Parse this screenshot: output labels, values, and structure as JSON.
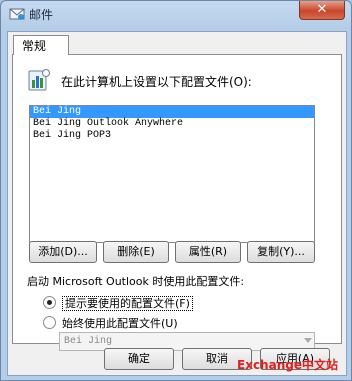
{
  "window": {
    "title": "邮件",
    "close_glyph": "✕"
  },
  "tabs": [
    {
      "label": "常规"
    }
  ],
  "profiles": {
    "prompt": "在此计算机上设置以下配置文件(O):",
    "items": [
      {
        "name": "Bei Jing",
        "selected": true
      },
      {
        "name": "Bei Jing Outlook Anywhere",
        "selected": false
      },
      {
        "name": "Bei Jing POP3",
        "selected": false
      }
    ]
  },
  "actions": {
    "add": "添加(D)...",
    "remove": "删除(E)",
    "properties": "属性(R)",
    "copy": "复制(Y)..."
  },
  "startup": {
    "label": "启动 Microsoft Outlook 时使用此配置文件:",
    "prompt_option": "提示要使用的配置文件(F)",
    "always_option": "始终使用此配置文件(U)",
    "selected_option": "prompt",
    "profile_select_value": "Bei Jing"
  },
  "footer": {
    "ok": "确定",
    "cancel": "取消",
    "apply": "应用(A)"
  },
  "watermark": "Exchange中文站",
  "colors": {
    "selection": "#3399ff",
    "watermark": "#e02020",
    "titlebar": "#b4cde8"
  }
}
